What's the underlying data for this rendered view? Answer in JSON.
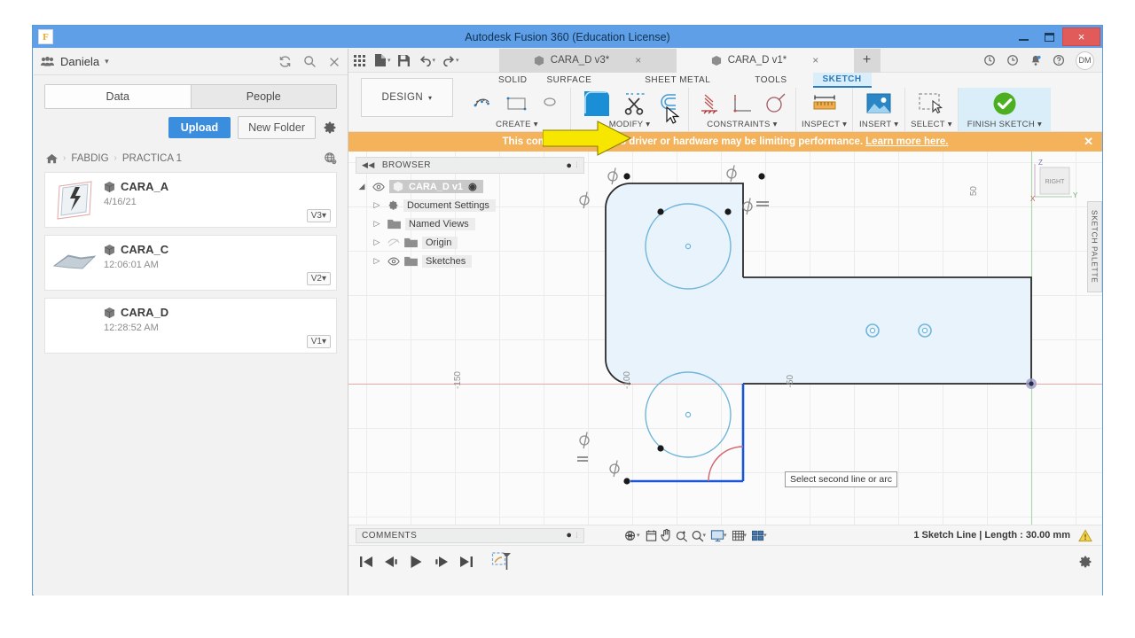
{
  "window": {
    "title": "Autodesk Fusion 360 (Education License)",
    "app_icon": "F",
    "minimize": "minimize-icon",
    "maximize": "maximize-icon",
    "close": "×"
  },
  "data_panel": {
    "user": "Daniela",
    "user_caret": "▾",
    "refresh_icon": "refresh-icon",
    "search_icon": "search-icon",
    "close_icon": "×",
    "tabs": [
      {
        "label": "Data",
        "active": true
      },
      {
        "label": "People",
        "active": false
      }
    ],
    "upload_label": "Upload",
    "new_folder_label": "New Folder",
    "settings_icon": "gear-icon",
    "breadcrumb": {
      "home_icon": "home-icon",
      "sep": "›",
      "items": [
        "FABDIG",
        "PRACTICA 1"
      ],
      "globe_icon": "globe-icon"
    },
    "files": [
      {
        "name": "CARA_A",
        "date": "4/16/21",
        "version": "V3",
        "caret": "▾"
      },
      {
        "name": "CARA_C",
        "date": "12:06:01 AM",
        "version": "V2",
        "caret": "▾"
      },
      {
        "name": "CARA_D",
        "date": "12:28:52 AM",
        "version": "V1",
        "caret": "▾"
      }
    ]
  },
  "quick_access": {
    "grid_icon": "app-grid-icon",
    "file_icon": "file-icon",
    "save_icon": "save-icon",
    "undo_icon": "undo-icon",
    "redo_icon": "redo-icon",
    "caret": "▾",
    "doc_tabs": [
      {
        "label": "CARA_D v3*",
        "active": false,
        "close": "×"
      },
      {
        "label": "CARA_D v1*",
        "active": true,
        "close": "×"
      }
    ],
    "new_tab": "+",
    "job_status_icon": "job-status-icon",
    "recent_icon": "clock-icon",
    "notifications_icon": "bell-icon",
    "help_icon": "help-icon",
    "avatar_initials": "DM"
  },
  "ribbon": {
    "design_label": "DESIGN",
    "design_caret": "▾",
    "workspace_tabs": [
      {
        "label": "SOLID",
        "active": false
      },
      {
        "label": "SURFACE",
        "active": false
      },
      {
        "label": "SHEET METAL",
        "active": false
      },
      {
        "label": "TOOLS",
        "active": false
      },
      {
        "label": "SKETCH",
        "active": true
      }
    ],
    "groups": [
      {
        "label": "CREATE",
        "caret": "▾",
        "tools": [
          "sketch-arc-icon",
          "sketch-rectangle-icon",
          "sketch-circle-icon"
        ]
      },
      {
        "label": "MODIFY",
        "caret": "▾",
        "tools": [
          "fillet-icon",
          "trim-scissors-icon",
          "offset-icon"
        ]
      },
      {
        "label": "CONSTRAINTS",
        "caret": "▾",
        "tools": [
          "horizontal-vertical-constraint-icon",
          "coincident-constraint-icon",
          "tangent-constraint-icon"
        ]
      },
      {
        "label": "INSPECT",
        "caret": "▾",
        "tools": [
          "measure-icon"
        ]
      },
      {
        "label": "INSERT",
        "caret": "▾",
        "tools": [
          "insert-image-icon"
        ]
      },
      {
        "label": "SELECT",
        "caret": "▾",
        "tools": [
          "select-window-icon"
        ]
      },
      {
        "label": "FINISH SKETCH",
        "caret": "▾",
        "tools": [
          "finish-sketch-check-icon"
        ]
      }
    ],
    "annotation_arrow": "yellow-arrow-pointing-at-fillet"
  },
  "warning_banner": {
    "message": "This computer's graphics driver or hardware may be limiting performance.",
    "link": "Learn more here.",
    "close": "✕"
  },
  "browser": {
    "title": "BROWSER",
    "collapse_icon": "◀◀",
    "dot_icon": "●",
    "tree": [
      {
        "label": "CARA_D v1",
        "selected": true,
        "expander": "◢",
        "eye": "eye-icon",
        "icon": "component-icon",
        "radio": "◉"
      },
      {
        "label": "Document Settings",
        "expander": "▷",
        "icon": "gear-icon"
      },
      {
        "label": "Named Views",
        "expander": "▷",
        "icon": "folder-icon"
      },
      {
        "label": "Origin",
        "expander": "▷",
        "eye": "eye-hidden-icon",
        "icon": "folder-icon"
      },
      {
        "label": "Sketches",
        "expander": "▷",
        "eye": "eye-icon",
        "icon": "folder-icon"
      }
    ]
  },
  "canvas": {
    "viewcube_label": "RIGHT",
    "axis_z": "Z",
    "axis_y": "Y",
    "axis_x": "X",
    "dimension_labels": [
      "-150",
      "-100",
      "-50",
      "50"
    ],
    "tooltip": "Select second line or arc",
    "sketch_palette_tab": "SKETCH PALETTE",
    "sketch_palette_collapse": "◀◀",
    "colors": {
      "sketch_profile_fill": "#e8f3fb",
      "sketch_edge": "#2b2b2b",
      "selected_edge": "#1a56d6",
      "circle_blue": "#6fb6da",
      "preview_fillet": "#d4646e",
      "x_axis": "#e29a9a",
      "y_axis": "#9fcf9f"
    }
  },
  "comments": {
    "title": "COMMENTS",
    "dot_icon": "●"
  },
  "nav_tools": {
    "orbit_icon": "orbit-icon",
    "display_settings_icon": "display-settings-icon",
    "pan_icon": "pan-hand-icon",
    "zoom_window_icon": "zoom-window-icon",
    "zoom_icon": "zoom-icon",
    "display_icon": "display-icon",
    "grid_snap_icon": "grid-snap-icon",
    "viewports_icon": "viewports-icon",
    "caret": "▾"
  },
  "status": {
    "text": "1 Sketch Line | Length : 30.00 mm",
    "warning_icon": "warning-triangle-icon"
  },
  "timeline": {
    "buttons": [
      "skip-to-start-icon",
      "step-back-icon",
      "play-icon",
      "step-forward-icon",
      "skip-to-end-icon"
    ],
    "sketch_marker_icon": "timeline-sketch-marker-icon",
    "settings_icon": "gear-icon"
  }
}
